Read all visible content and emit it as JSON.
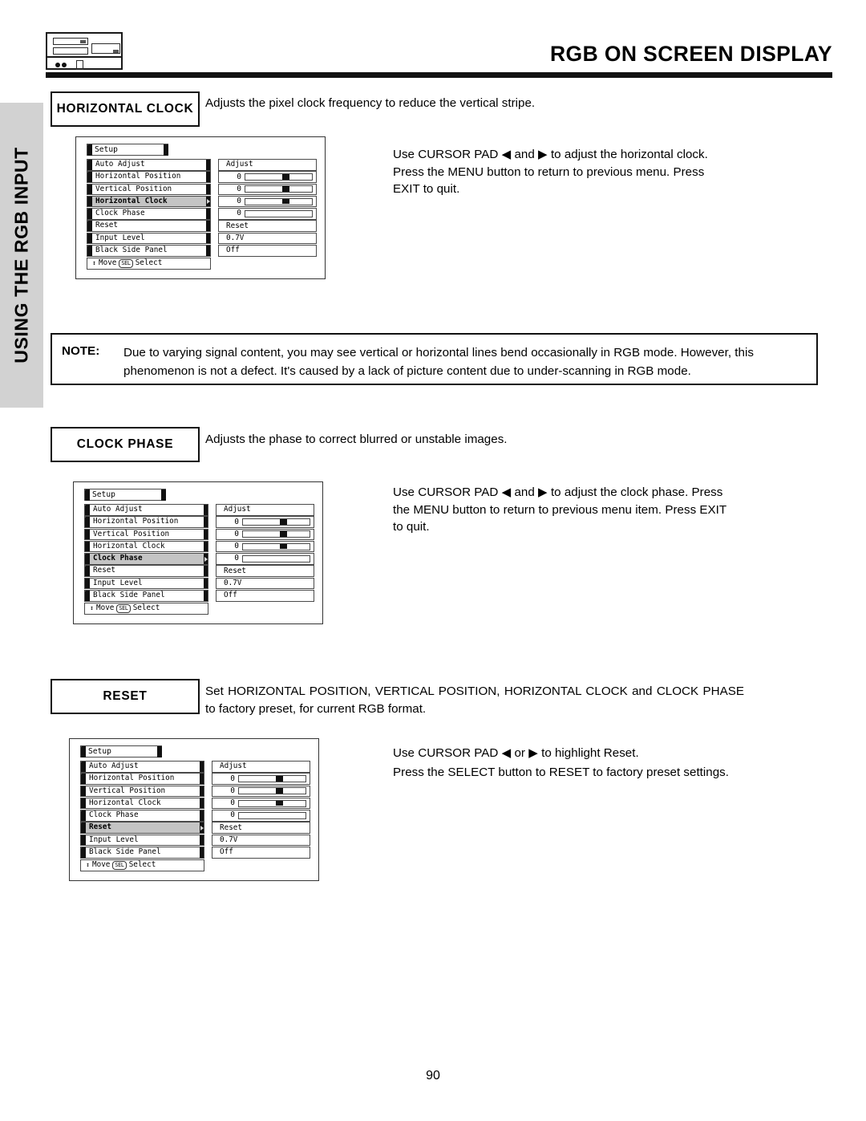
{
  "header": {
    "title": "RGB ON SCREEN DISPLAY",
    "logo_icon": "tv-front-panel-icon"
  },
  "side_tab": {
    "label": "USING THE RGB INPUT"
  },
  "page": {
    "number": "90"
  },
  "note": {
    "label": "NOTE:",
    "body": "Due to varying signal content, you may see vertical or horizontal lines bend occasionally in RGB mode.  However, this phenomenon is not a defect.  It's caused by a lack of picture content due to under-scanning in RGB mode."
  },
  "sections": [
    {
      "label": "HORIZONTAL CLOCK",
      "description": "Adjusts the pixel clock frequency to reduce the vertical stripe.",
      "instructions": "Use CURSOR PAD ◀ and ▶ to adjust the horizontal clock.  Press the MENU button to return to previous menu.  Press EXIT to quit.",
      "osd": {
        "title": "Setup",
        "selected": "Horizontal Clock",
        "footer_move": "Move",
        "footer_sel_chip": "SEL",
        "footer_select": "Select",
        "rows": [
          {
            "label": "Auto Adjust",
            "value_type": "text",
            "value": "Adjust"
          },
          {
            "label": "Horizontal Position",
            "value_type": "slider",
            "value": "0",
            "knob_pct": 55
          },
          {
            "label": "Vertical Position",
            "value_type": "slider",
            "value": "0",
            "knob_pct": 55
          },
          {
            "label": "Horizontal Clock",
            "value_type": "slider",
            "value": "0",
            "knob_pct": 55
          },
          {
            "label": "Clock Phase",
            "value_type": "slider",
            "value": "0",
            "knob_pct": -1
          },
          {
            "label": "Reset",
            "value_type": "text",
            "value": "Reset"
          },
          {
            "label": "Input Level",
            "value_type": "text",
            "value": "0.7V"
          },
          {
            "label": "Black Side Panel",
            "value_type": "text",
            "value": "Off"
          }
        ]
      }
    },
    {
      "label": "CLOCK PHASE",
      "description": "Adjusts the phase to correct blurred or unstable images.",
      "instructions": "Use CURSOR PAD ◀ and ▶ to adjust the clock phase. Press the MENU button to return to previous menu item. Press EXIT to quit.",
      "osd": {
        "title": "Setup",
        "selected": "Clock Phase",
        "footer_move": "Move",
        "footer_sel_chip": "SEL",
        "footer_select": "Select",
        "rows": [
          {
            "label": "Auto Adjust",
            "value_type": "text",
            "value": "Adjust"
          },
          {
            "label": "Horizontal Position",
            "value_type": "slider",
            "value": "0",
            "knob_pct": 55
          },
          {
            "label": "Vertical Position",
            "value_type": "slider",
            "value": "0",
            "knob_pct": 55
          },
          {
            "label": "Horizontal Clock",
            "value_type": "slider",
            "value": "0",
            "knob_pct": 55
          },
          {
            "label": "Clock Phase",
            "value_type": "slider",
            "value": "0",
            "knob_pct": -1
          },
          {
            "label": "Reset",
            "value_type": "text",
            "value": "Reset"
          },
          {
            "label": "Input Level",
            "value_type": "text",
            "value": "0.7V"
          },
          {
            "label": "Black Side Panel",
            "value_type": "text",
            "value": "Off"
          }
        ]
      }
    },
    {
      "label": "RESET",
      "description": "Set  HORIZONTAL  POSITION,  VERTICAL  POSITION,  HORIZONTAL  CLOCK   and  CLOCK PHASE to factory preset, for current RGB format.",
      "instructions_line1": "Use CURSOR PAD ◀ or  ▶ to highlight Reset.",
      "instructions_line2": "Press the SELECT button to RESET to factory preset settings.",
      "osd": {
        "title": "Setup",
        "selected": "Reset",
        "footer_move": "Move",
        "footer_sel_chip": "SEL",
        "footer_select": "Select",
        "rows": [
          {
            "label": "Auto Adjust",
            "value_type": "text",
            "value": "Adjust"
          },
          {
            "label": "Horizontal Position",
            "value_type": "slider",
            "value": "0",
            "knob_pct": 55
          },
          {
            "label": "Vertical Position",
            "value_type": "slider",
            "value": "0",
            "knob_pct": 55
          },
          {
            "label": "Horizontal Clock",
            "value_type": "slider",
            "value": "0",
            "knob_pct": 55
          },
          {
            "label": "Clock Phase",
            "value_type": "slider",
            "value": "0",
            "knob_pct": -1
          },
          {
            "label": "Reset",
            "value_type": "text",
            "value": "Reset"
          },
          {
            "label": "Input Level",
            "value_type": "text",
            "value": "0.7V"
          },
          {
            "label": "Black Side Panel",
            "value_type": "text",
            "value": "Off"
          }
        ]
      }
    }
  ]
}
